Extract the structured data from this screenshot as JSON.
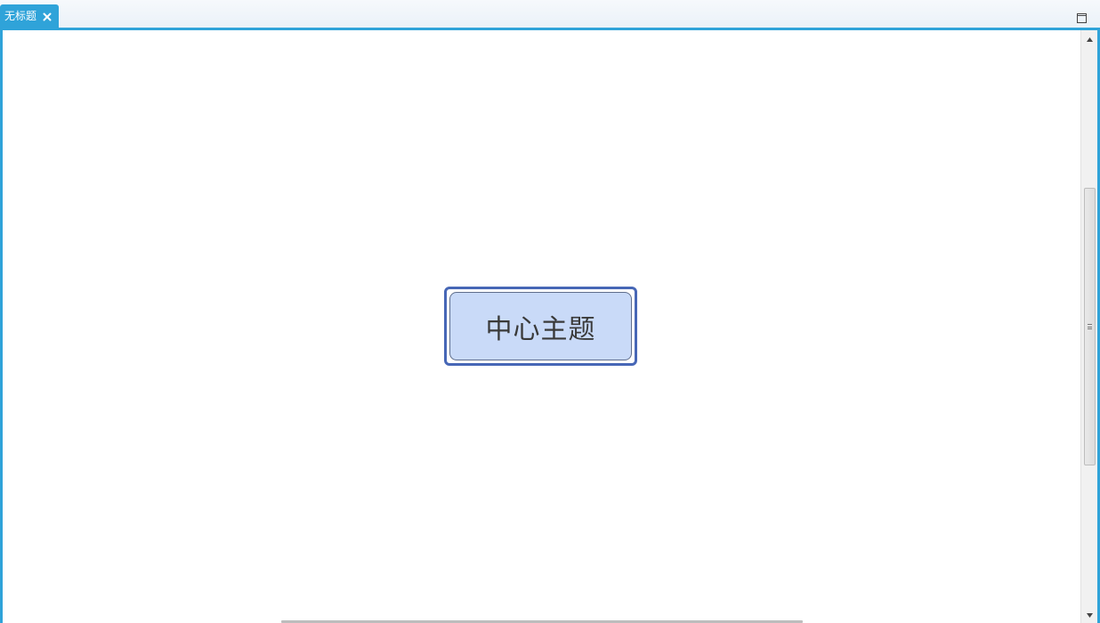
{
  "tab": {
    "label": "无标题",
    "close_icon": "close-icon"
  },
  "window": {
    "maximize_icon": "maximize-icon"
  },
  "mindmap": {
    "central_topic": "中心主题"
  },
  "colors": {
    "accent": "#2fa3d9",
    "topic_border": "#4767b6",
    "topic_fill": "#c9daf8"
  }
}
